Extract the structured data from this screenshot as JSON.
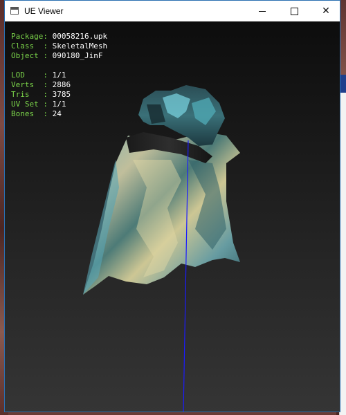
{
  "window": {
    "title": "UE Viewer",
    "controls": {
      "minimize_icon": "minimize-icon",
      "maximize_icon": "maximize-icon",
      "close_icon": "close-icon",
      "close_glyph": "✕"
    }
  },
  "info_panel": {
    "package": {
      "label": "Package: ",
      "value": "00058216.upk"
    },
    "class": {
      "label": "Class  : ",
      "value": "SkeletalMesh"
    },
    "object": {
      "label": "Object : ",
      "value": "090180_JinF"
    },
    "lod": {
      "label": "LOD    : ",
      "value": "1/1"
    },
    "verts": {
      "label": "Verts  : ",
      "value": "2886"
    },
    "tris": {
      "label": "Tris   : ",
      "value": "3785"
    },
    "uvset": {
      "label": "UV Set : ",
      "value": "1/1"
    },
    "bones": {
      "label": "Bones  : ",
      "value": "24"
    }
  },
  "colors": {
    "label_green": "#7bd44a",
    "value_white": "#ffffff",
    "bone_line": "#1b1bff",
    "window_border": "#2a6fb1"
  }
}
